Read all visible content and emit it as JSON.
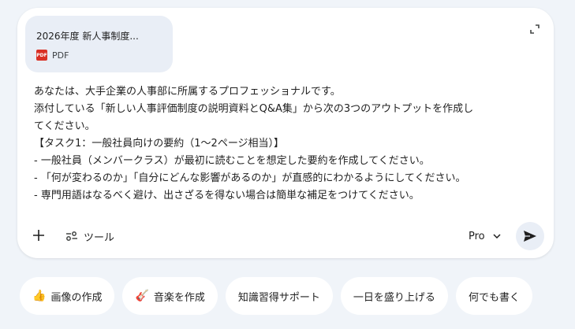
{
  "attachment": {
    "title": "2026年度 新人事制度...",
    "type_label": "PDF",
    "icon_text": "PDF",
    "icon": "pdf-file-icon"
  },
  "prompt": {
    "lines": [
      "あなたは、大手企業の人事部に所属するプロフェッショナルです。",
      "添付している「新しい人事評価制度の説明資料とQ&A集」から次の3つのアウトプットを作成し",
      "てください。",
      "【タスク1：一般社員向けの要約（1〜2ページ相当）】",
      "- 一般社員（メンバークラス）が最初に読むことを想定した要約を作成してください。",
      "- 「何が変わるのか」「自分にどんな影響があるのか」が直感的にわかるようにしてください。",
      "- 専門用語はなるべく避け、出さざるを得ない場合は簡単な補足をつけてください。"
    ]
  },
  "toolbar": {
    "add_icon": "plus-icon",
    "tools_label": "ツール",
    "tools_icon": "tools-sliders-icon",
    "model_label": "Pro",
    "model_icon": "chevron-down-icon",
    "send_icon": "send-icon",
    "expand_icon": "expand-icon"
  },
  "chips": [
    {
      "icon": "👍",
      "label": "画像の作成"
    },
    {
      "icon": "🎸",
      "label": "音楽を作成"
    },
    {
      "icon": "",
      "label": "知識習得サポート"
    },
    {
      "icon": "",
      "label": "一日を盛り上げる"
    },
    {
      "icon": "",
      "label": "何でも書く"
    }
  ],
  "colors": {
    "page_background": "#f0f4f9",
    "card_background": "#ffffff",
    "attachment_background": "#e9eef6",
    "pdf_icon": "#d93025"
  }
}
